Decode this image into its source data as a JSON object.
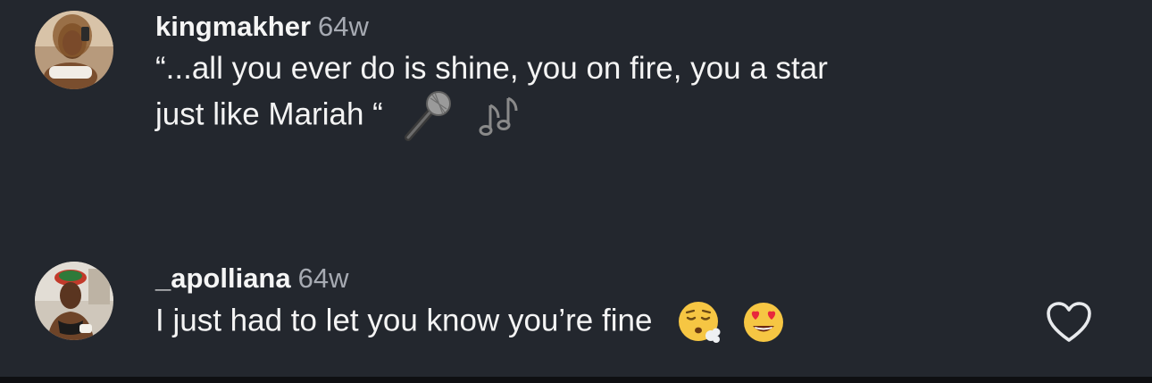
{
  "comments": [
    {
      "username": "kingmakher",
      "time": "64w",
      "text_line1": "“...all you ever do is shine, you on fire, you a star",
      "text_line2": "just like Mariah “",
      "emojis": [
        "microphone-icon",
        "musical-notes-icon"
      ]
    },
    {
      "username": "_apolliana",
      "time": "64w",
      "text": "I just had to let you know you’re fine",
      "emojis": [
        "face-exhaling-icon",
        "heart-eyes-icon"
      ],
      "like_icon": "heart-outline-icon"
    }
  ],
  "colors": {
    "background": "#23272e",
    "text": "#f4f4f4",
    "muted": "#a6aab2"
  }
}
